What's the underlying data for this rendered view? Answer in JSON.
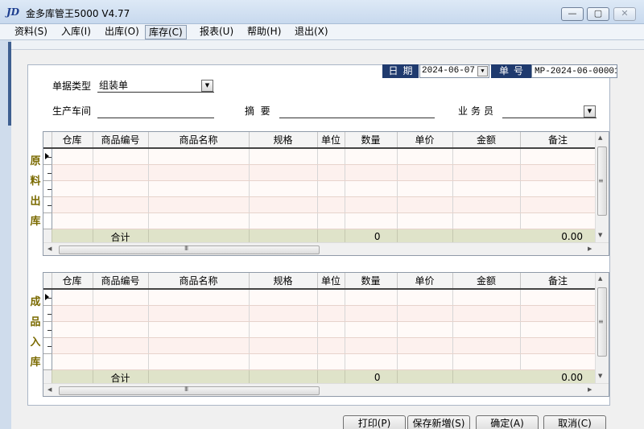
{
  "window": {
    "logo": "JD",
    "title": "金多库管王5000 V4.77",
    "min": "▭",
    "max": "▢",
    "close": "✕"
  },
  "menu": [
    {
      "label": "资料(S)"
    },
    {
      "label": "入库(I)"
    },
    {
      "label": "出库(O)"
    },
    {
      "label": "库存(C)",
      "active": true
    },
    {
      "label": "报表(U)"
    },
    {
      "label": "帮助(H)"
    },
    {
      "label": "退出(X)"
    }
  ],
  "header": {
    "date_label": "日期",
    "date_value": "2024-06-07",
    "number_label": "单号",
    "number_value": "MP-2024-06-00001",
    "doc_type_label": "单据类型",
    "doc_type_value": "组装单",
    "workshop_label": "生产车间",
    "workshop_value": "",
    "summary_label": "摘  要",
    "summary_value": "",
    "salesman_label": "业务员",
    "salesman_value": ""
  },
  "grid_columns": [
    "仓库",
    "商品编号",
    "商品名称",
    "规格",
    "单位",
    "数量",
    "单价",
    "金额",
    "备注"
  ],
  "raw_section": {
    "side_label": [
      "原",
      "料",
      "出",
      "库"
    ],
    "total_label": "合计",
    "total_qty": "0",
    "total_amount": "0.00"
  },
  "finished_section": {
    "side_label": [
      "成",
      "品",
      "入",
      "库"
    ],
    "total_label": "合计",
    "total_qty": "0",
    "total_amount": "0.00"
  },
  "buttons": {
    "print": "打印(P)",
    "save_new": "保存新増(S)",
    "ok": "确定(A)",
    "cancel": "取消(C)"
  },
  "scroll": {
    "up": "▲",
    "down": "▼",
    "left": "◀",
    "right": "▶",
    "grip_v": "≡",
    "grip_h": "III"
  }
}
